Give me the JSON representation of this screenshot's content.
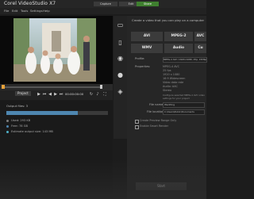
{
  "app": {
    "title": "Corel VideoStudio X7"
  },
  "workspace_tabs": [
    {
      "label": "Capture"
    },
    {
      "label": "Edit"
    },
    {
      "label": "Share"
    }
  ],
  "menu": [
    "File",
    "Edit",
    "Tools",
    "Settings",
    "Help"
  ],
  "player": {
    "project_label": "Project",
    "timecode": "00:00:00:00",
    "buttons": [
      "play",
      "previous",
      "rewind",
      "forward",
      "next",
      "repeat",
      "volume",
      "fullscreen"
    ]
  },
  "output": {
    "title": "Output files: 3",
    "progress": 0.7,
    "stats": [
      {
        "label": "Used: 293 KB",
        "color": "#7d7d7d"
      },
      {
        "label": "Free: 78 GB",
        "color": "#4e86b0"
      },
      {
        "label": "Estimate output size: 143 MB",
        "color": "#4fb1c8"
      }
    ]
  },
  "side_tools": [
    "computer-icon",
    "device-icon",
    "web-icon",
    "disc-icon",
    "3d-icon"
  ],
  "right": {
    "header": "Create a video that you can play on a computer",
    "formats": [
      [
        "AVI",
        "MPEG-2",
        "AVC"
      ],
      [
        "WMV",
        "Audio",
        "Cu"
      ]
    ],
    "profile_label": "Profile:",
    "profile_value": "MPEG-4 AVC (1920×1080, 25p, 15Mbps)",
    "properties_label": "Properties:",
    "properties_lines": [
      "MPEG-4 AVC",
      "25 fps",
      "1920 x 1080",
      "16:9 Widescreen",
      "Video data rate",
      "Audio: AAC",
      "Stereo"
    ],
    "note": "Configure selected MPEG-4 AVC video settings for your project",
    "file_name_label": "File name:",
    "file_name_value": "Wedding",
    "location_label": "File location:",
    "location_value": "C:\\Users\\Public\\Documents",
    "options": [
      "Create Preview Range Only",
      "Enable Smart Render"
    ],
    "start_label": "Start"
  }
}
